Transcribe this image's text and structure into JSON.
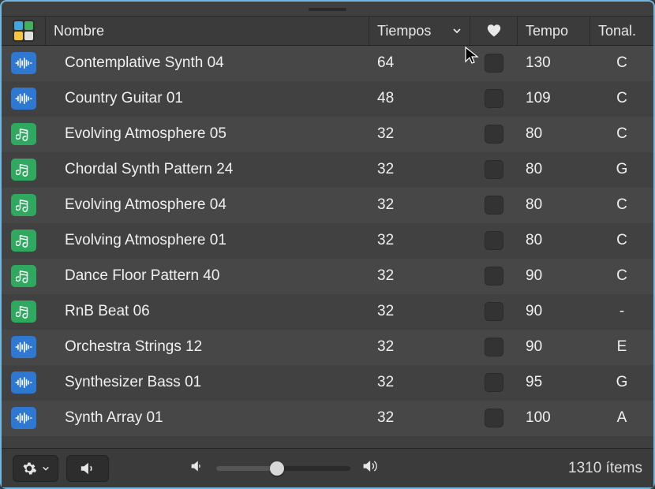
{
  "header": {
    "nombre": "Nombre",
    "tiempos": "Tiempos",
    "tempo": "Tempo",
    "tonal": "Tonal."
  },
  "rows": [
    {
      "type": "audio",
      "name": "Contemplative Synth 04",
      "tiempos": "64",
      "tempo": "130",
      "tonal": "C"
    },
    {
      "type": "audio",
      "name": "Country Guitar 01",
      "tiempos": "48",
      "tempo": "109",
      "tonal": "C"
    },
    {
      "type": "midi",
      "name": "Evolving Atmosphere 05",
      "tiempos": "32",
      "tempo": "80",
      "tonal": "C"
    },
    {
      "type": "midi",
      "name": "Chordal Synth Pattern 24",
      "tiempos": "32",
      "tempo": "80",
      "tonal": "G"
    },
    {
      "type": "midi",
      "name": "Evolving Atmosphere 04",
      "tiempos": "32",
      "tempo": "80",
      "tonal": "C"
    },
    {
      "type": "midi",
      "name": "Evolving Atmosphere 01",
      "tiempos": "32",
      "tempo": "80",
      "tonal": "C"
    },
    {
      "type": "midi",
      "name": "Dance Floor Pattern 40",
      "tiempos": "32",
      "tempo": "90",
      "tonal": "C"
    },
    {
      "type": "midi",
      "name": "RnB Beat 06",
      "tiempos": "32",
      "tempo": "90",
      "tonal": "-"
    },
    {
      "type": "audio",
      "name": "Orchestra Strings 12",
      "tiempos": "32",
      "tempo": "90",
      "tonal": "E"
    },
    {
      "type": "audio",
      "name": "Synthesizer Bass 01",
      "tiempos": "32",
      "tempo": "95",
      "tonal": "G"
    },
    {
      "type": "audio",
      "name": "Synth Array 01",
      "tiempos": "32",
      "tempo": "100",
      "tonal": "A"
    }
  ],
  "footer": {
    "count": "1310 ítems"
  }
}
